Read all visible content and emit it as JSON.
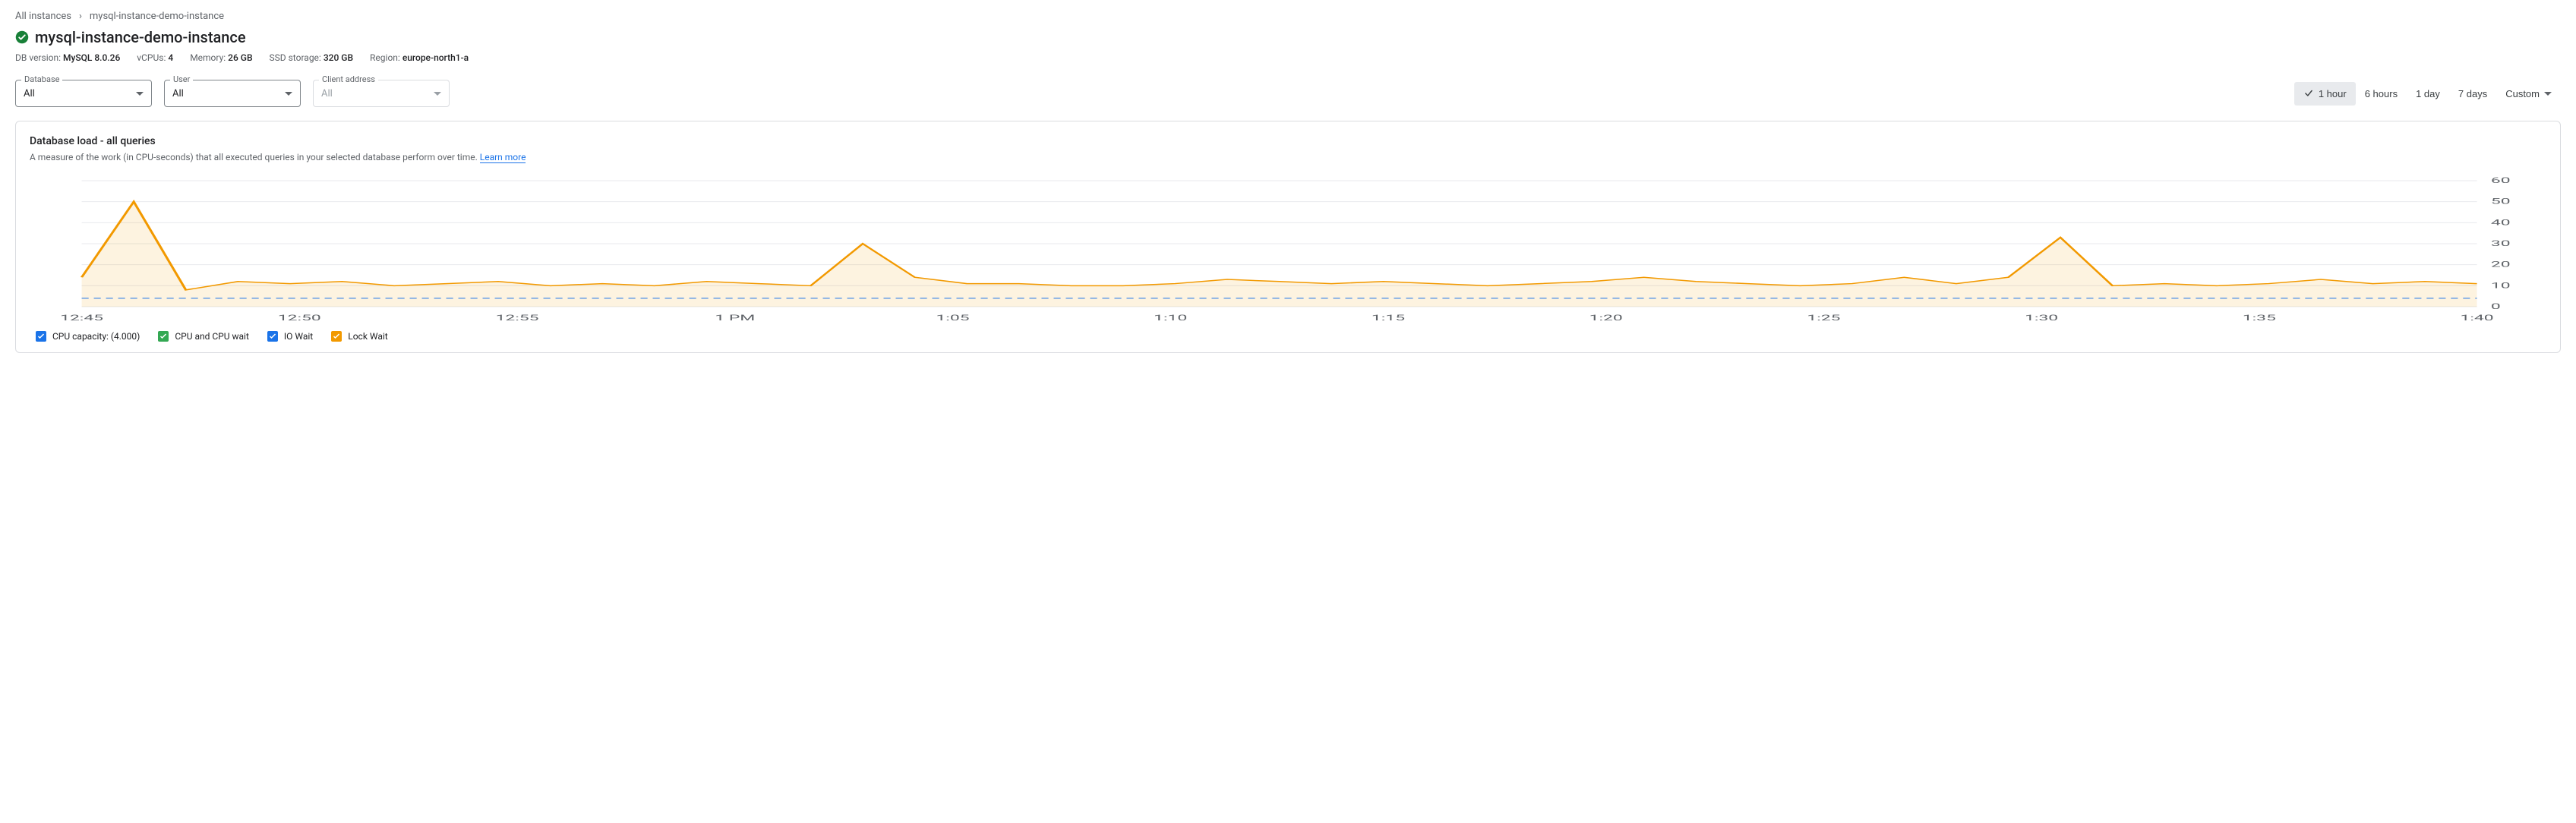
{
  "breadcrumb": {
    "root": "All instances",
    "current": "mysql-instance-demo-instance"
  },
  "title": "mysql-instance-demo-instance",
  "meta": {
    "dbversion_label": "DB version:",
    "dbversion": "MySQL 8.0.26",
    "vcpus_label": "vCPUs:",
    "vcpus": "4",
    "memory_label": "Memory:",
    "memory": "26 GB",
    "ssd_label": "SSD storage:",
    "ssd": "320 GB",
    "region_label": "Region:",
    "region": "europe-north1-a"
  },
  "filters": {
    "database_label": "Database",
    "database_value": "All",
    "user_label": "User",
    "user_value": "All",
    "client_label": "Client address",
    "client_value": "All"
  },
  "time_range": {
    "hour1": "1 hour",
    "hours6": "6 hours",
    "day1": "1 day",
    "days7": "7 days",
    "custom": "Custom"
  },
  "panel": {
    "title": "Database load - all queries",
    "desc": "A measure of the work (in CPU-seconds) that all executed queries in your selected database perform over time.",
    "learn_more": "Learn more"
  },
  "legend": {
    "cpu_capacity": "CPU capacity: (4.000)",
    "cpu_wait": "CPU and CPU wait",
    "io_wait": "IO Wait",
    "lock_wait": "Lock Wait"
  },
  "chart_data": {
    "type": "area",
    "x_ticks": [
      "12:45",
      "12:50",
      "12:55",
      "1 PM",
      "1:05",
      "1:10",
      "1:15",
      "1:20",
      "1:25",
      "1:30",
      "1:35",
      "1:40"
    ],
    "y_ticks": [
      0,
      10,
      20,
      30,
      40,
      50,
      60
    ],
    "ylim": [
      0,
      60
    ],
    "capacity_line": 4,
    "series": [
      {
        "name": "Lock Wait",
        "color": "#f29900",
        "values": [
          14,
          50,
          8,
          12,
          11,
          12,
          10,
          11,
          12,
          10,
          11,
          10,
          12,
          11,
          10,
          30,
          14,
          11,
          11,
          10,
          10,
          11,
          13,
          12,
          11,
          12,
          11,
          10,
          11,
          12,
          14,
          12,
          11,
          10,
          11,
          14,
          11,
          14,
          33,
          10,
          11,
          10,
          11,
          13,
          11,
          12,
          11
        ]
      }
    ]
  }
}
